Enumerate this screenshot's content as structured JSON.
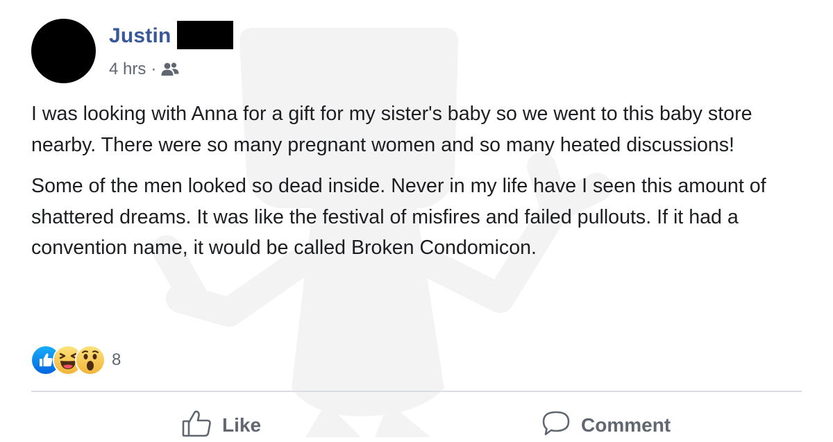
{
  "post": {
    "author_name": "Justin",
    "timestamp": "4 hrs",
    "separator": "·",
    "audience_icon": "friends-icon",
    "paragraphs": [
      "I was looking with Anna for a gift for my sister's baby so we went to this baby store nearby. There were so many pregnant women and so many heated discussions!",
      "Some of the men looked so dead inside. Never in my life have I seen this amount of shattered dreams. It was like the festival of misfires and failed pullouts. If it had a convention name, it would be called Broken Condomicon."
    ],
    "reactions": {
      "types": [
        "like-reaction-icon",
        "haha-reaction-icon",
        "wow-reaction-icon"
      ],
      "count": "8"
    }
  },
  "actions": {
    "like_label": "Like",
    "comment_label": "Comment"
  },
  "colors": {
    "author_link": "#385898",
    "meta_text": "#606770",
    "body_text": "#1c1e21",
    "like_blue": "#1877f2",
    "emoji_yellow": "#f7c53a",
    "watermark": "#f2f2f2"
  }
}
